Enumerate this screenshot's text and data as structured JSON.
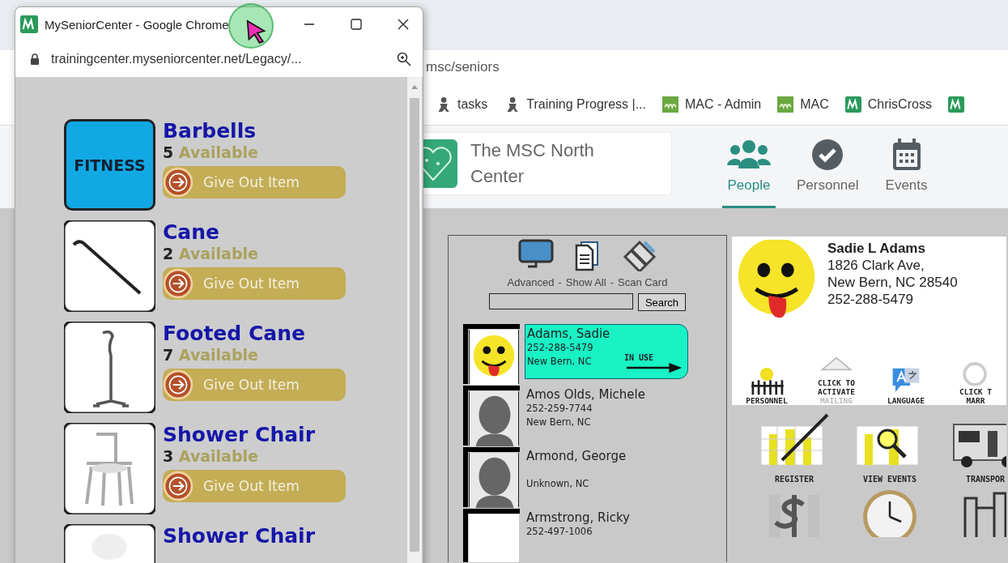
{
  "browser": {
    "url_tail": "msc/seniors",
    "bookmarks": [
      {
        "label": "tasks",
        "kind": "person"
      },
      {
        "label": "Training Progress |...",
        "kind": "person"
      },
      {
        "label": "MAC - Admin",
        "kind": "my"
      },
      {
        "label": "MAC",
        "kind": "my"
      },
      {
        "label": "ChrisCross",
        "kind": "m"
      },
      {
        "kind": "m"
      }
    ]
  },
  "site": {
    "center_name": "The MSC North Center",
    "tabs": [
      {
        "label": "People",
        "kind": "people",
        "selected": true
      },
      {
        "label": "Personnel",
        "kind": "check",
        "selected": false
      },
      {
        "label": "Events",
        "kind": "calendar",
        "selected": false
      }
    ]
  },
  "search_panel": {
    "tools": [
      {
        "label": "Advanced",
        "kind": "monitor"
      },
      {
        "label": "Show All",
        "kind": "documents"
      },
      {
        "label": "Scan Card",
        "kind": "card"
      }
    ],
    "separator": "-",
    "search_button": "Search",
    "people": [
      {
        "name": "Adams, Sadie",
        "phone": "252-288-5479",
        "city": "New Bern, NC",
        "kind": "smiley",
        "selected": true,
        "badge": "IN USE"
      },
      {
        "name": "Amos Olds, Michele",
        "phone": "252-259-7744",
        "city": "New Bern, NC",
        "kind": "silhouette",
        "selected": false
      },
      {
        "name": "Armond, George",
        "city": "Unknown, NC",
        "kind": "silhouette",
        "selected": false
      },
      {
        "name": "Armstrong, Ricky",
        "phone": "252-497-1006",
        "kind": "blank",
        "selected": false
      }
    ]
  },
  "profile": {
    "name": "Sadie L Adams",
    "address_lines": [
      "1826 Clark Ave,",
      "New Bern, NC 28540"
    ],
    "phone": "252-288-5479",
    "actions": [
      {
        "kind": "personnel",
        "lines": [
          {
            "text": "PERSONNEL",
            "dim": false
          }
        ]
      },
      {
        "kind": "mailing",
        "lines": [
          {
            "text": "CLICK TO",
            "dim": false
          },
          {
            "text": "ACTIVATE",
            "dim": false
          },
          {
            "text": "MAILING",
            "dim": true
          }
        ]
      },
      {
        "kind": "language",
        "lines": [
          {
            "text": "LANGUAGE",
            "dim": false
          }
        ]
      },
      {
        "kind": "marry",
        "lines": [
          {
            "text": "CLICK T",
            "dim": false
          },
          {
            "text": "MARR",
            "dim": false
          }
        ]
      }
    ],
    "tiles": [
      {
        "kind": "register",
        "label": "REGISTER"
      },
      {
        "kind": "view-events",
        "label": "VIEW EVENTS"
      },
      {
        "kind": "transport",
        "label": "TRANSPOR"
      },
      {
        "kind": "payments"
      },
      {
        "kind": "volunteer"
      },
      {
        "kind": "equipment"
      }
    ]
  },
  "popup": {
    "title": "MySeniorCenter - Google Chrome",
    "url": "trainingcenter.myseniorcenter.net/Legacy/...",
    "items": [
      {
        "name": "Barbells",
        "count": "5",
        "available": "Available",
        "button": "Give Out Item",
        "kind": "fitness",
        "image_text": "FITNESS"
      },
      {
        "name": "Cane",
        "count": "2",
        "available": "Available",
        "button": "Give Out Item",
        "kind": "cane"
      },
      {
        "name": "Footed Cane",
        "count": "7",
        "available": "Available",
        "button": "Give Out Item",
        "kind": "footed-cane"
      },
      {
        "name": "Shower Chair",
        "count": "3",
        "available": "Available",
        "button": "Give Out Item",
        "kind": "shower-chair"
      },
      {
        "name": "Shower Chair",
        "kind": "chair-back"
      }
    ]
  }
}
